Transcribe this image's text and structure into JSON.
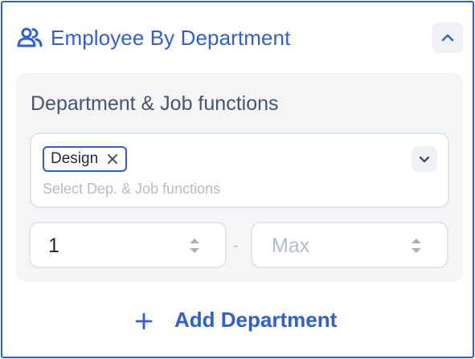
{
  "header": {
    "title": "Employee By Department",
    "icon": "users-icon",
    "collapse_icon": "chevron-up-icon"
  },
  "department": {
    "label": "Department & Job functions",
    "selected_chips": [
      {
        "label": "Design"
      }
    ],
    "placeholder": "Select Dep. & Job functions",
    "dropdown_icon": "chevron-down-icon"
  },
  "range": {
    "min_value": "1",
    "max_placeholder": "Max",
    "separator": "-"
  },
  "add_button": {
    "label": "Add Department"
  },
  "colors": {
    "accent": "#2f5fd4",
    "card_bg": "#f4f5f7",
    "border": "#e2e5ea",
    "placeholder": "#b4bcc8"
  }
}
